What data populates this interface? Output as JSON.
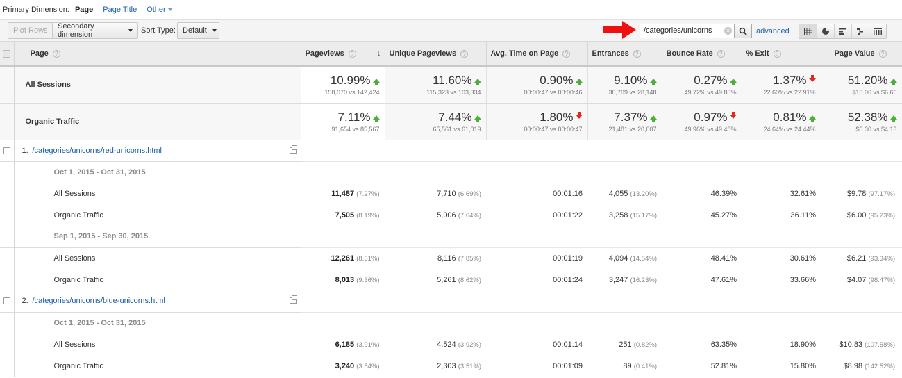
{
  "primary_dimension": {
    "label": "Primary Dimension:",
    "active": "Page",
    "options": [
      "Page Title",
      "Other"
    ]
  },
  "toolbar": {
    "plot_rows": "Plot Rows",
    "secondary_dimension": "Secondary dimension",
    "sort_type_label": "Sort Type:",
    "sort_type_value": "Default",
    "search_value": "/categories/unicorns",
    "advanced": "advanced"
  },
  "columns": [
    "Page",
    "Pageviews",
    "Unique Pageviews",
    "Avg. Time on Page",
    "Entrances",
    "Bounce Rate",
    "% Exit",
    "Page Value"
  ],
  "summary": [
    {
      "name": "All Sessions",
      "metrics": [
        {
          "pct": "10.99%",
          "dir": "up",
          "cmp": "158,070 vs 142,424"
        },
        {
          "pct": "11.60%",
          "dir": "up",
          "cmp": "115,323 vs 103,334"
        },
        {
          "pct": "0.90%",
          "dir": "up",
          "cmp": "00:00:47 vs 00:00:46"
        },
        {
          "pct": "9.10%",
          "dir": "up",
          "cmp": "30,709 vs 28,148"
        },
        {
          "pct": "0.27%",
          "dir": "up",
          "cmp": "49.72% vs 49.85%"
        },
        {
          "pct": "1.37%",
          "dir": "down",
          "cmp": "22.60% vs 22.91%"
        },
        {
          "pct": "51.20%",
          "dir": "up",
          "cmp": "$10.06 vs $6.66"
        }
      ]
    },
    {
      "name": "Organic Traffic",
      "metrics": [
        {
          "pct": "7.11%",
          "dir": "up",
          "cmp": "91,654 vs 85,567"
        },
        {
          "pct": "7.44%",
          "dir": "up",
          "cmp": "65,561 vs 61,019"
        },
        {
          "pct": "1.80%",
          "dir": "down",
          "cmp": "00:00:47 vs 00:00:47"
        },
        {
          "pct": "7.37%",
          "dir": "up",
          "cmp": "21,481 vs 20,007"
        },
        {
          "pct": "0.97%",
          "dir": "down",
          "cmp": "49.96% vs 49.48%"
        },
        {
          "pct": "0.81%",
          "dir": "up",
          "cmp": "24.64% vs 24.44%"
        },
        {
          "pct": "52.38%",
          "dir": "up",
          "cmp": "$6.30 vs $4.13"
        }
      ]
    }
  ],
  "pages": [
    {
      "index": "1.",
      "path": "/categories/unicorns/red-unicorns.html",
      "ranges": [
        {
          "date": "Oct 1, 2015 - Oct 31, 2015",
          "rows": [
            {
              "segment": "All Sessions",
              "pv": "11,487",
              "pv_pct": "(7.27%)",
              "upv": "7,710",
              "upv_pct": "(6.69%)",
              "time": "00:01:16",
              "ent": "4,055",
              "ent_pct": "(13.20%)",
              "bounce": "46.39%",
              "exit": "32.61%",
              "value": "$9.78",
              "value_pct": "(97.17%)"
            },
            {
              "segment": "Organic Traffic",
              "pv": "7,505",
              "pv_pct": "(8.19%)",
              "upv": "5,006",
              "upv_pct": "(7.64%)",
              "time": "00:01:22",
              "ent": "3,258",
              "ent_pct": "(15.17%)",
              "bounce": "45.27%",
              "exit": "36.11%",
              "value": "$6.00",
              "value_pct": "(95.23%)"
            }
          ]
        },
        {
          "date": "Sep 1, 2015 - Sep 30, 2015",
          "rows": [
            {
              "segment": "All Sessions",
              "pv": "12,261",
              "pv_pct": "(8.61%)",
              "upv": "8,116",
              "upv_pct": "(7.85%)",
              "time": "00:01:19",
              "ent": "4,094",
              "ent_pct": "(14.54%)",
              "bounce": "48.41%",
              "exit": "30.61%",
              "value": "$6.21",
              "value_pct": "(93.34%)"
            },
            {
              "segment": "Organic Traffic",
              "pv": "8,013",
              "pv_pct": "(9.36%)",
              "upv": "5,261",
              "upv_pct": "(8.62%)",
              "time": "00:01:24",
              "ent": "3,247",
              "ent_pct": "(16.23%)",
              "bounce": "47.61%",
              "exit": "33.66%",
              "value": "$4.07",
              "value_pct": "(98.47%)"
            }
          ]
        }
      ]
    },
    {
      "index": "2.",
      "path": "/categories/unicorns/blue-unicorns.html",
      "ranges": [
        {
          "date": "Oct 1, 2015 - Oct 31, 2015",
          "rows": [
            {
              "segment": "All Sessions",
              "pv": "6,185",
              "pv_pct": "(3.91%)",
              "upv": "4,524",
              "upv_pct": "(3.92%)",
              "time": "00:01:14",
              "ent": "251",
              "ent_pct": "(0.82%)",
              "bounce": "63.35%",
              "exit": "18.90%",
              "value": "$10.83",
              "value_pct": "(107.58%)"
            },
            {
              "segment": "Organic Traffic",
              "pv": "3,240",
              "pv_pct": "(3.54%)",
              "upv": "2,303",
              "upv_pct": "(3.51%)",
              "time": "00:01:09",
              "ent": "89",
              "ent_pct": "(0.41%)",
              "bounce": "52.81%",
              "exit": "15.80%",
              "value": "$8.98",
              "value_pct": "(142.52%)"
            }
          ]
        }
      ]
    }
  ],
  "colors": {
    "link": "#1a5ea8",
    "up": "#4caf3a",
    "down": "#e0281f",
    "annotation_arrow": "#ee1111"
  },
  "icons": [
    "search-icon",
    "clear-icon",
    "table-view-icon",
    "pie-view-icon",
    "performance-view-icon",
    "comparison-view-icon",
    "pivot-view-icon",
    "popup-icon",
    "sort-desc-icon",
    "help-icon"
  ]
}
